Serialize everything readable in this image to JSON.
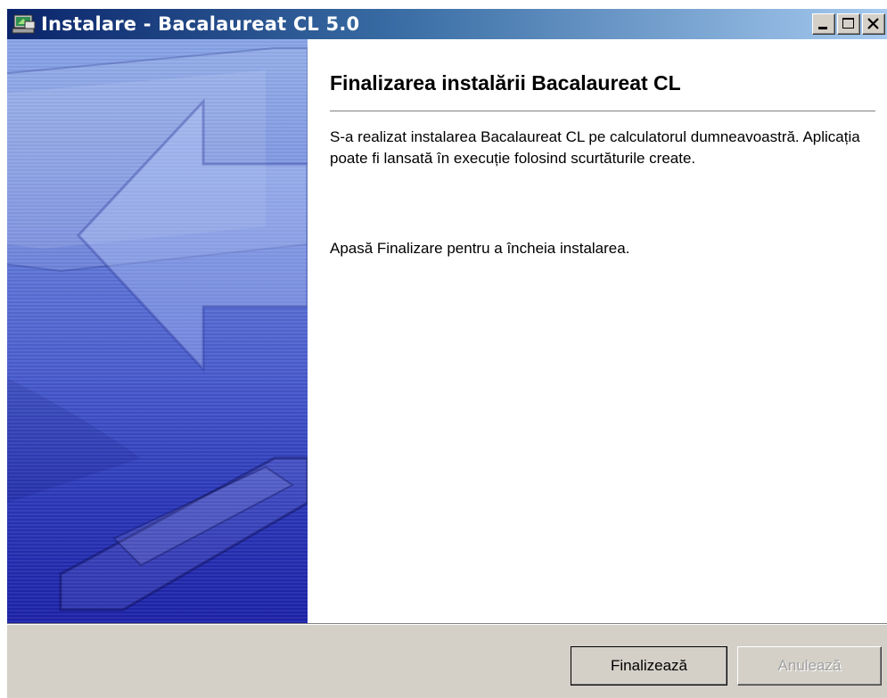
{
  "window": {
    "title": "Instalare - Bacalaureat CL 5.0",
    "title_buttons": [
      "minimize",
      "maximize",
      "close"
    ]
  },
  "icons": {
    "app": "installer-computer-icon",
    "minimize": "minimize-icon",
    "maximize": "maximize-icon",
    "close": "close-icon"
  },
  "content": {
    "heading": "Finalizarea instalării Bacalaureat CL",
    "paragraph1": "S-a realizat instalarea Bacalaureat CL pe calculatorul dumneavoastră. Aplicația poate fi lansată în execuție folosind scurtăturile create.",
    "paragraph2": "Apasă Finalizare pentru a încheia instalarea."
  },
  "buttons": {
    "finish_label": "Finalizează",
    "cancel_label": "Anulează",
    "cancel_enabled": false
  },
  "colors": {
    "titlebar_start": "#0a246a",
    "titlebar_end": "#a6caf0",
    "sidebar_top": "#8aa6e8",
    "sidebar_bottom": "#1c22a8",
    "face": "#d4d0c8"
  }
}
